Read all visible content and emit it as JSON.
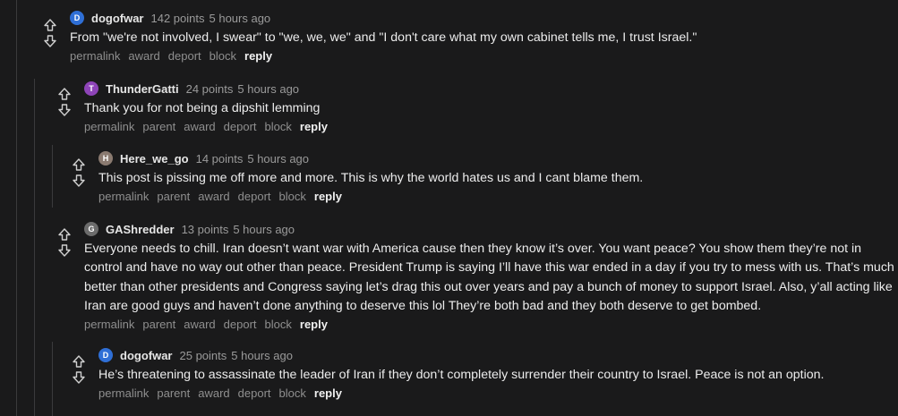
{
  "comments": [
    {
      "avatar_letter": "D",
      "avatar_color": "#2f6fd6",
      "author": "dogofwar",
      "points": "142 points",
      "time": "5 hours ago",
      "body": "From \"we're not involved, I swear\" to \"we, we, we\" and \"I don't care what my own cabinet tells me, I trust Israel.\"",
      "actions": {
        "permalink": "permalink",
        "award": "award",
        "deport": "deport",
        "block": "block",
        "reply": "reply"
      }
    },
    {
      "avatar_letter": "T",
      "avatar_color": "#8e44b8",
      "author": "ThunderGatti",
      "points": "24 points",
      "time": "5 hours ago",
      "body": "Thank you for not being a dipshit lemming",
      "actions": {
        "permalink": "permalink",
        "parent": "parent",
        "award": "award",
        "deport": "deport",
        "block": "block",
        "reply": "reply"
      }
    },
    {
      "avatar_letter": "H",
      "avatar_color": "#8a7a70",
      "author": "Here_we_go",
      "points": "14 points",
      "time": "5 hours ago",
      "body": "This post is pissing me off more and more. This is why the world hates us and I cant blame them.",
      "actions": {
        "permalink": "permalink",
        "parent": "parent",
        "award": "award",
        "deport": "deport",
        "block": "block",
        "reply": "reply"
      }
    },
    {
      "avatar_letter": "G",
      "avatar_color": "#6c6c6c",
      "author": "GAShredder",
      "points": "13 points",
      "time": "5 hours ago",
      "body": "Everyone needs to chill. Iran doesn’t want war with America cause then they know it’s over. You want peace? You show them they’re not in control and have no way out other than peace. President Trump is saying I’ll have this war ended in a day if you try to mess with us. That’s much better than other presidents and Congress saying let’s drag this out over years and pay a bunch of money to support Israel. Also, y’all acting like Iran are good guys and haven’t done anything to deserve this lol They’re both bad and they both deserve to get bombed.",
      "actions": {
        "permalink": "permalink",
        "parent": "parent",
        "award": "award",
        "deport": "deport",
        "block": "block",
        "reply": "reply"
      }
    },
    {
      "avatar_letter": "D",
      "avatar_color": "#2f6fd6",
      "author": "dogofwar",
      "points": "25 points",
      "time": "5 hours ago",
      "body": "He’s threatening to assassinate the leader of Iran if they don’t completely surrender their country to Israel. Peace is not an option.",
      "actions": {
        "permalink": "permalink",
        "parent": "parent",
        "award": "award",
        "deport": "deport",
        "block": "block",
        "reply": "reply"
      }
    }
  ]
}
